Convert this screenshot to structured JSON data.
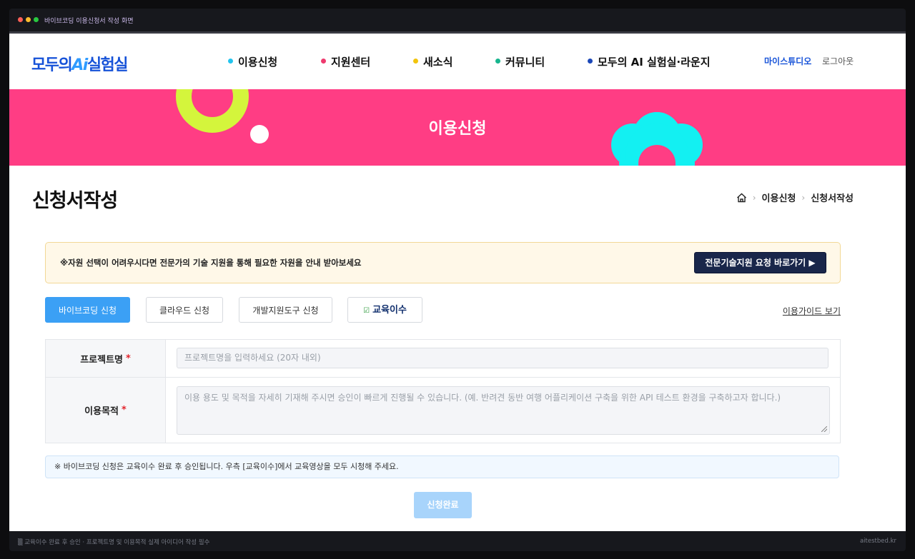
{
  "window": {
    "title": "바이브코딩 이용신청서 작성 화면"
  },
  "header": {
    "logo_main": "모두의",
    "logo_ai": "Ai",
    "logo_tail": "실험실",
    "nav": [
      {
        "label": "이용신청",
        "color": "#22c4ee"
      },
      {
        "label": "지원센터",
        "color": "#ee3a6e"
      },
      {
        "label": "새소식",
        "color": "#f2c40c"
      },
      {
        "label": "커뮤니티",
        "color": "#17b58e"
      },
      {
        "label": "모두의 AI 실험실·라운지",
        "color": "#1b47b8"
      }
    ],
    "my_studio": "마이스튜디오",
    "logout": "로그아웃"
  },
  "banner": {
    "title": "이용신청",
    "bg_color": "#ff3d84"
  },
  "page": {
    "title": "신청서작성",
    "breadcrumb": [
      "이용신청",
      "신청서작성"
    ],
    "home_icon": "home-icon"
  },
  "notice": {
    "text": "※자원 선택이 어려우시다면 전문가의 기술 지원을 통해 필요한 자원을 안내 받아보세요",
    "button": "전문기술지원 요청 바로가기 ▶"
  },
  "tabs": [
    {
      "label": "바이브코딩 신청",
      "active": true
    },
    {
      "label": "클라우드 신청",
      "active": false
    },
    {
      "label": "개발지원도구 신청",
      "active": false
    },
    {
      "label": "교육이수",
      "active": false,
      "check_icon": "☑"
    }
  ],
  "guide_link": "이용가이드 보기",
  "form": {
    "project_name": {
      "label": "프로젝트명",
      "required": "*",
      "value": "",
      "placeholder": "프로젝트명을 입력하세요 (20자 내외)"
    },
    "purpose": {
      "label": "이용목적",
      "required": "*",
      "value": "",
      "placeholder": "이용 용도 및 목적을 자세히 기재해 주시면 승인이 빠르게 진행될 수 있습니다. (예. 반려견 동반 여행 어플리케이션 구축을 위한 API 테스트 환경을 구축하고자 합니다.)"
    }
  },
  "info_note": "※ 바이브코딩 신청은 교육이수 완료 후 승인됩니다. 우측 [교육이수]에서 교육영상을 모두 시청해 주세요.",
  "submit_label": "신청완료",
  "footer": {
    "left": "▒ 교육이수 완료 후 승인 · 프로젝트명 및 이용목적 실제 아이디어 작성 필수",
    "right": "aitestbed.kr"
  }
}
